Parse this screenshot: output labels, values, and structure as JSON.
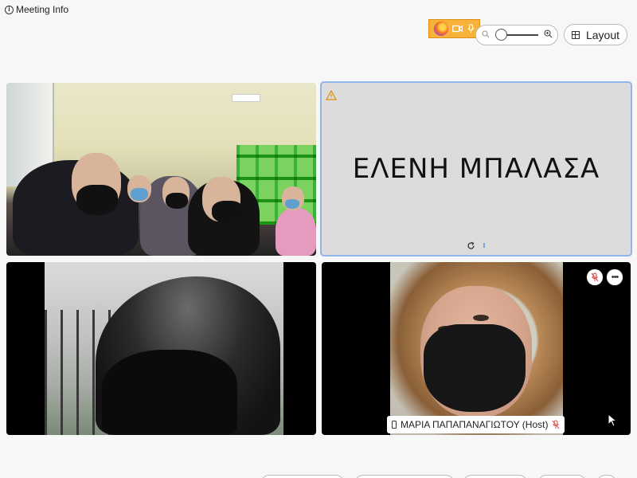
{
  "header": {
    "meeting_info_label": "Meeting Info",
    "meeting_info_icon": "info-icon",
    "layout_label": "Layout",
    "zoom": {
      "min_icon": "zoom-out-icon",
      "max_icon": "zoom-in-icon"
    },
    "sharing_indicator": {
      "icons": [
        "firefox-icon",
        "camera-icon",
        "microphone-icon"
      ],
      "color": "#f6b23a"
    }
  },
  "tiles": [
    {
      "id": "classroom",
      "kind": "video"
    },
    {
      "id": "eleni",
      "kind": "avatar",
      "display_name": "ΕΛΕΝΗ ΜΠΑΛΑΣΑ",
      "status_icon": "warning-icon",
      "loading_icon": "refresh-icon",
      "border_color": "#8fb6e8"
    },
    {
      "id": "man",
      "kind": "video"
    },
    {
      "id": "maria",
      "kind": "video",
      "label": "ΜΑΡΙΑ ΠΑΠΑΠΑΝΑΓΙΩΤΟΥ (Host)",
      "muted": true
    }
  ],
  "colors": {
    "background": "#f7f7f7",
    "muted": "#d9534f"
  }
}
